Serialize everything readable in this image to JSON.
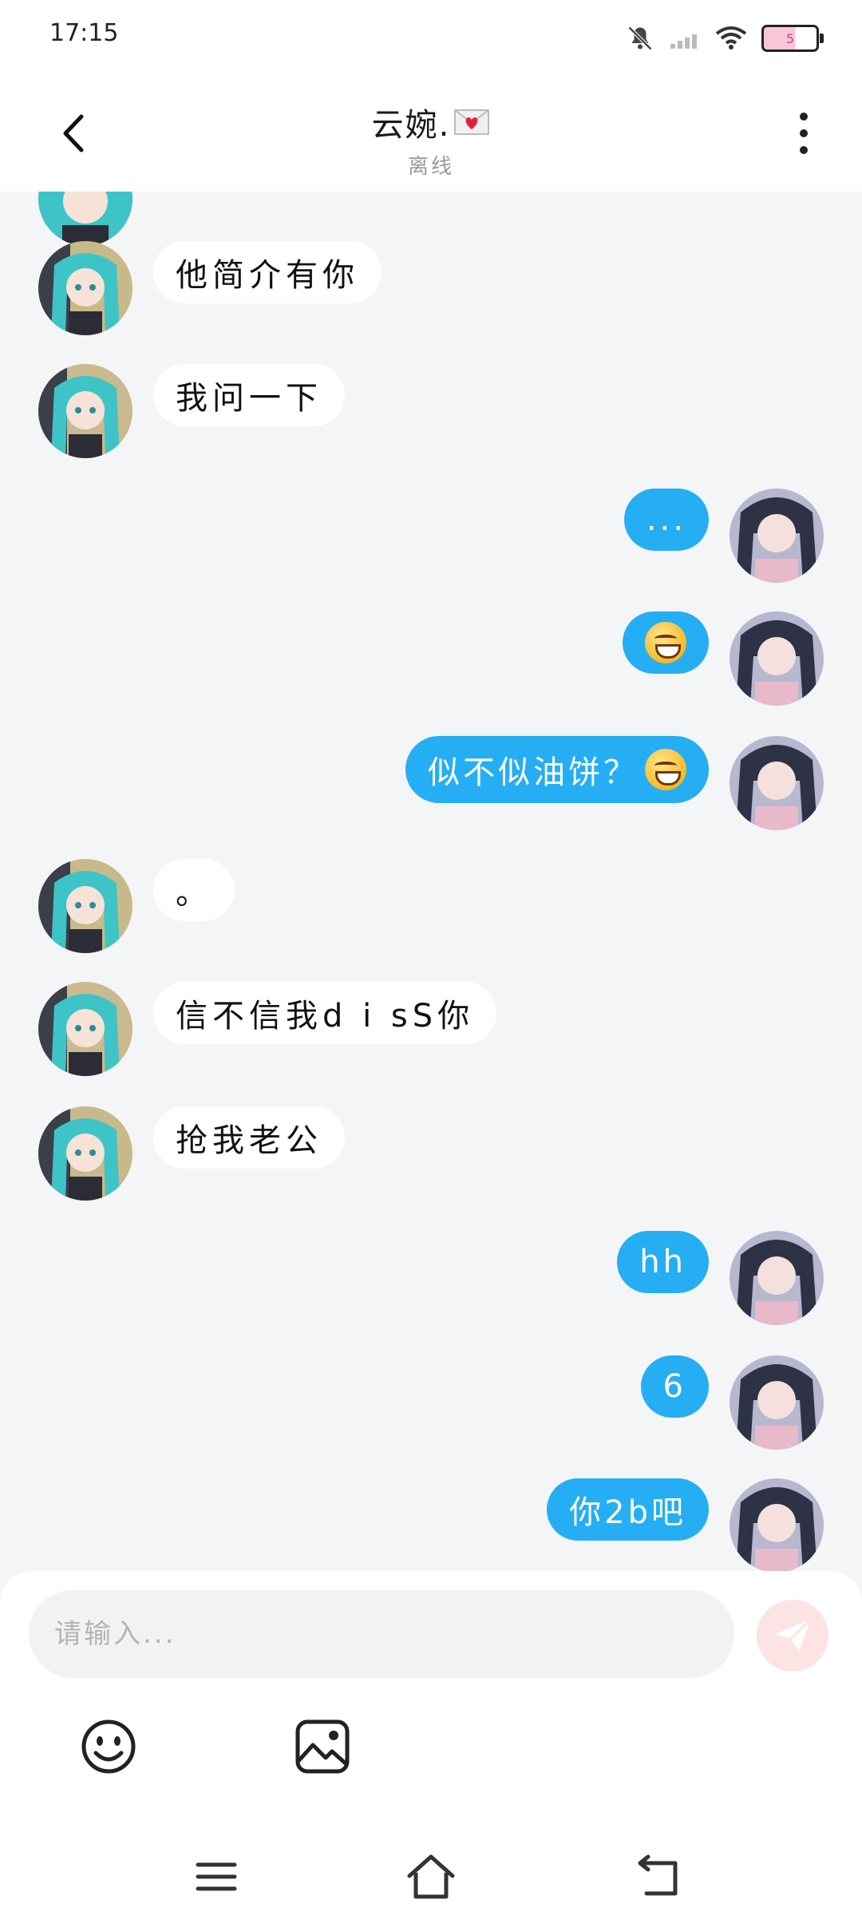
{
  "status": {
    "time": "17:15",
    "battery": "5"
  },
  "header": {
    "title": "云婉.",
    "subtitle": "离线"
  },
  "messages": [
    {
      "side": "theirs",
      "text": "他简介有你"
    },
    {
      "side": "theirs",
      "text": "我问一下"
    },
    {
      "side": "mine",
      "text": "..."
    },
    {
      "side": "mine",
      "text": "",
      "emoji": "grinning-sweat"
    },
    {
      "side": "mine",
      "text": "似不似油饼？",
      "emoji": "grinning-sweat"
    },
    {
      "side": "theirs",
      "text": "。"
    },
    {
      "side": "theirs",
      "text": "信不信我d i sS你"
    },
    {
      "side": "theirs",
      "text": "抢我老公"
    },
    {
      "side": "mine",
      "text": "hh"
    },
    {
      "side": "mine",
      "text": "6"
    },
    {
      "side": "mine",
      "text": "你2b吧"
    }
  ],
  "input": {
    "placeholder": "请输入..."
  },
  "colors": {
    "my_bubble": "#25aef3",
    "their_bubble": "#ffffff",
    "background": "#f4f5f7",
    "send_button": "#fde4e4"
  },
  "icons": {
    "back": "chevron-left-icon",
    "more": "more-vertical-icon",
    "send": "send-icon",
    "emoji": "smiley-icon",
    "image": "image-icon",
    "nav_menu": "menu-icon",
    "nav_home": "home-icon",
    "nav_back": "nav-back-icon"
  }
}
